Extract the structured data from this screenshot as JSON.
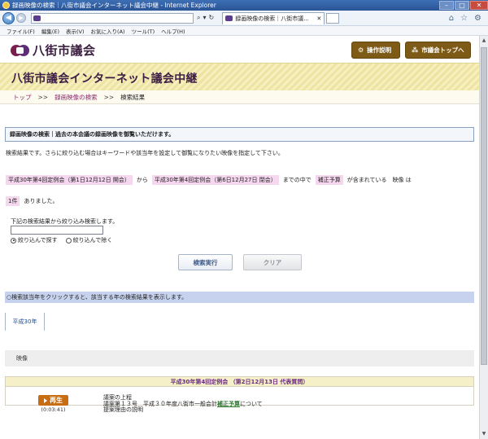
{
  "window": {
    "title": "録画映像の検索｜八街市議会インターネット議会中継 - Internet Explorer",
    "tab_title": "録画映像の検索｜八街市議..."
  },
  "menu": {
    "items": [
      "ファイル(F)",
      "編集(E)",
      "表示(V)",
      "お気に入り(A)",
      "ツール(T)",
      "ヘルプ(H)"
    ]
  },
  "header": {
    "logo_text": "八街市議会",
    "manual_button": "操作説明",
    "top_button": "市議会トップへ"
  },
  "banner": {
    "title": "八街市議会インターネット議会中継"
  },
  "breadcrumb": {
    "top": "トップ",
    "search": "録画映像の検索",
    "sep": ">>",
    "current": "検索結果"
  },
  "notice": "録画映像の検索｜過去の本会議の録画映像を御覧いただけます。",
  "intro": "検索結果です。さらに絞り込む場合はキーワードや該当年を設定して御覧になりたい映像を指定して下さい。",
  "criteria": {
    "from_label": "平成30年第4回定例会（第1日12月12日 開会）",
    "from_text": "から",
    "to_label": "平成30年第4回定例会（第6日12月27日 閉会）",
    "between_text": "までの中で",
    "keyword": "補正予算",
    "contains_text": "が含まれている　映像 は",
    "count": "1件",
    "found_text": "ありました。"
  },
  "refine": {
    "label": "下記の検索結果から絞り込み検索します。",
    "input_value": "",
    "radio_include": "絞り込んで探す",
    "radio_exclude": "絞り込んで除く"
  },
  "buttons": {
    "search": "検索実行",
    "clear": "クリア"
  },
  "year_notice": "○検索該当年をクリックすると、該当する年の検索結果を表示します。",
  "year_tab": "平成30年",
  "video_header": "映像",
  "result": {
    "session": "平成30年第4回定例会 （第2日12月13日 代表質問）",
    "play_label": "再生",
    "duration": "(0:03:41)",
    "line1": "議案の上程",
    "line2_prefix": "議案第１３号　平成３０年度八街市一般会計",
    "line2_keyword": "補正予算",
    "line2_suffix": "について",
    "line3": "提案理由の説明"
  },
  "colors": {
    "brand": "#7d5a16",
    "banner_title": "#3d1e45",
    "highlight": "#f5d7ef",
    "link": "#8a2c6f",
    "play": "#c96d12"
  }
}
